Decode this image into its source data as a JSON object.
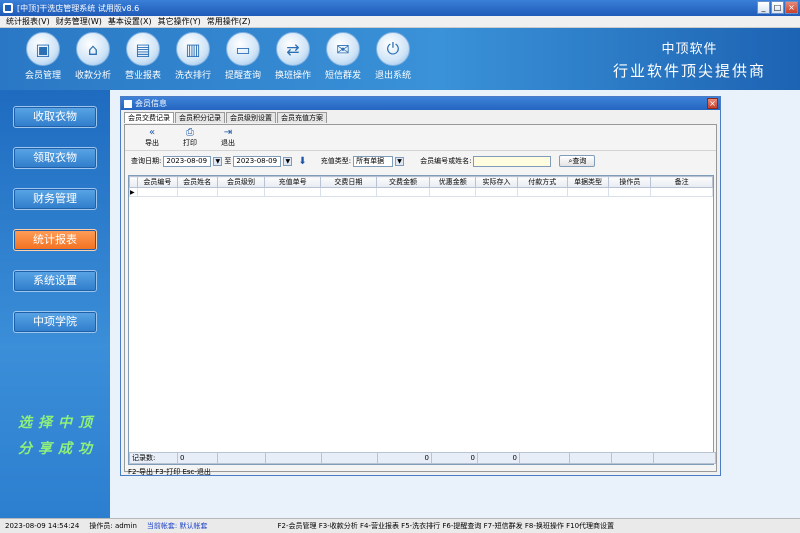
{
  "window": {
    "title": "[中顶]干洗店管理系统 试用版v8.6"
  },
  "menu": [
    "统计报表(V)",
    "财务管理(W)",
    "基本设置(X)",
    "其它操作(Y)",
    "常用操作(Z)"
  ],
  "toolbar": [
    {
      "label": "会员管理",
      "icon": "member-card-icon",
      "glyph": "▣"
    },
    {
      "label": "收款分析",
      "icon": "home-icon",
      "glyph": "⌂"
    },
    {
      "label": "营业报表",
      "icon": "report-icon",
      "glyph": "▤"
    },
    {
      "label": "洗衣排行",
      "icon": "bar-chart-icon",
      "glyph": "▥"
    },
    {
      "label": "提醒查询",
      "icon": "chat-bubble-icon",
      "glyph": "▭"
    },
    {
      "label": "换班操作",
      "icon": "swap-icon",
      "glyph": "⇄"
    },
    {
      "label": "短信群发",
      "icon": "mail-icon",
      "glyph": "✉"
    },
    {
      "label": "退出系统",
      "icon": "power-icon",
      "glyph": "⏻"
    }
  ],
  "brand": {
    "line1": "中顶软件",
    "line2": "行业软件顶尖提供商"
  },
  "sidebar": [
    {
      "label": "收取衣物",
      "active": false
    },
    {
      "label": "领取衣物",
      "active": false
    },
    {
      "label": "财务管理",
      "active": false
    },
    {
      "label": "统计报表",
      "active": true
    },
    {
      "label": "系统设置",
      "active": false
    },
    {
      "label": "中项学院",
      "active": false
    }
  ],
  "slogan": {
    "line1": "选择中顶",
    "line2": "分享成功"
  },
  "dialog": {
    "title": "会员信息",
    "tabs": [
      "会员交费记录",
      "会员积分记录",
      "会员级别设置",
      "会员充值方案"
    ],
    "tools": [
      {
        "label": "导出",
        "glyph": "«"
      },
      {
        "label": "打印",
        "glyph": "⎙"
      },
      {
        "label": "退出",
        "glyph": "⇥"
      }
    ],
    "filter": {
      "date_label": "查询日期:",
      "date_from": "2023-08-09",
      "to_label": "至",
      "date_to": "2023-08-09",
      "type_label": "充值类型:",
      "type_value": "所有单据",
      "name_label": "会员编号或姓名:",
      "name_value": "",
      "query_label": "查询"
    },
    "columns": [
      "会员编号",
      "会员姓名",
      "会员级别",
      "充值单号",
      "交费日期",
      "交费金额",
      "优惠金额",
      "实际存入",
      "付款方式",
      "单据类型",
      "操作员",
      "备注"
    ],
    "footer": {
      "count_label": "记录数:",
      "count": "0",
      "amount": "0",
      "discount": "0",
      "actual": "0"
    },
    "hint": "F2-导出 F3-打印 Esc-退出"
  },
  "status": {
    "datetime": "2023-08-09 14:54:24",
    "operator": "操作员: admin",
    "account": "当前帐套: 默认帐套",
    "shortcuts": "F2-会员管理 F3-收款分析 F4-营业报表 F5-洗衣排行 F6-提醒查询 F7-短信群发 F8-换班操作 F10代理商设置"
  }
}
